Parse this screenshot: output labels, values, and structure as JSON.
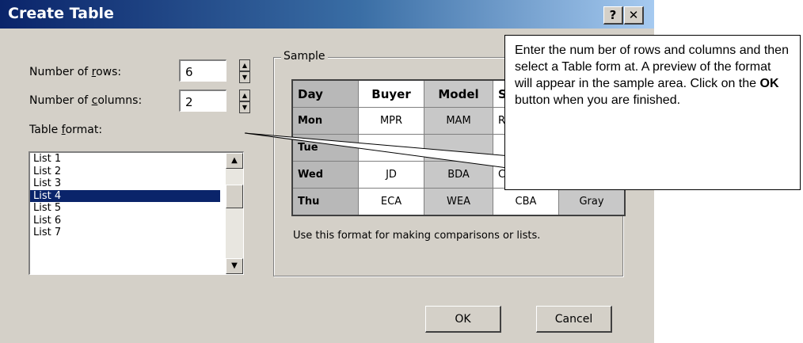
{
  "dialog": {
    "title": "Create Table",
    "help_button": "?",
    "close_button": "✕"
  },
  "rows": {
    "label_prefix": "Number of ",
    "label_accel": "r",
    "label_suffix": "ows:",
    "value": "6"
  },
  "columns": {
    "label_prefix": "Number of ",
    "label_accel": "c",
    "label_suffix": "olumns:",
    "value": "2"
  },
  "format": {
    "label_prefix": "Table ",
    "label_accel": "f",
    "label_suffix": "ormat:",
    "items": [
      "List 1",
      "List 2",
      "List 3",
      "List 4",
      "List 5",
      "List 6",
      "List 7"
    ],
    "selected": "List 4"
  },
  "sample": {
    "legend": "Sample",
    "headers": [
      "Day",
      "Buyer",
      "Model",
      "St"
    ],
    "rows": [
      [
        "Mon",
        "MPR",
        "MAM",
        "R"
      ],
      [
        "Tue",
        "",
        "",
        ""
      ],
      [
        "Wed",
        "JD",
        "BDA",
        "C"
      ],
      [
        "Thu",
        "ECA",
        "WEA",
        "CBA",
        "Gray"
      ]
    ],
    "hint": "Use this format for making comparisons or lists."
  },
  "buttons": {
    "ok": "OK",
    "cancel": "Cancel"
  },
  "callout": {
    "text_before": "Enter the num ber of rows and columns and then select a Table form at.  A preview of the format will appear in the sample area.  Click on the ",
    "bold": "OK",
    "text_after": " button when you are finished."
  }
}
